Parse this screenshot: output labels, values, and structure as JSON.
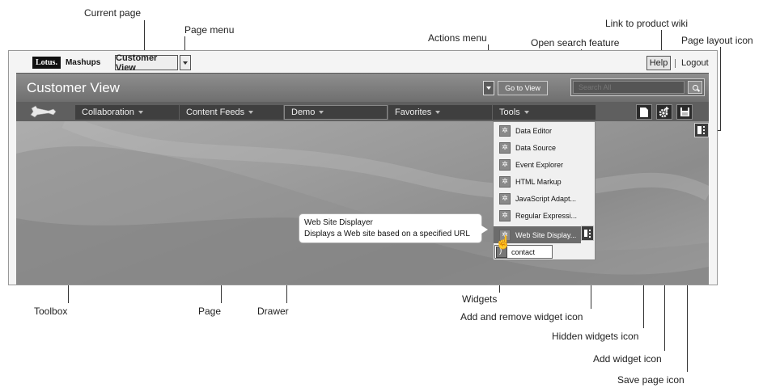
{
  "callouts": {
    "current_page": "Current page",
    "page_menu": "Page menu",
    "actions_menu": "Actions menu",
    "open_search": "Open search feature",
    "product_wiki": "Link to product wiki",
    "page_layout_icon": "Page layout icon",
    "toolbox": "Toolbox",
    "page": "Page",
    "drawer": "Drawer",
    "widgets": "Widgets",
    "add_remove_widget": "Add and remove widget icon",
    "hidden_widgets": "Hidden widgets icon",
    "add_widget": "Add widget icon",
    "save_page": "Save page icon"
  },
  "topbar": {
    "logo_lotus": "Lotus.",
    "logo_mashups": "Mashups",
    "current_page": "Customer View",
    "help": "Help",
    "logout": "Logout"
  },
  "header": {
    "title": "Customer View",
    "goto_label": "Go to View",
    "search_placeholder": "Search All"
  },
  "drawers": [
    {
      "label": "Collaboration"
    },
    {
      "label": "Content Feeds"
    },
    {
      "label": "Demo"
    },
    {
      "label": "Favorites"
    },
    {
      "label": "Tools"
    }
  ],
  "tools_menu": {
    "items": [
      {
        "label": "Data Editor"
      },
      {
        "label": "Data Source"
      },
      {
        "label": "Event Explorer"
      },
      {
        "label": "HTML Markup"
      },
      {
        "label": "JavaScript Adapt..."
      },
      {
        "label": "Regular Expressi..."
      },
      {
        "label": "Web Site Display..."
      }
    ],
    "contact": "contact"
  },
  "tooltip": {
    "title": "Web Site Displayer",
    "description": "Displays a Web site based on a specified URL"
  },
  "icons": {
    "toolbox": "wrench-icon",
    "hidden_widgets": "page-icon",
    "add_widget": "gear-plus-icon",
    "save_page": "floppy-disk-icon",
    "page_layout": "layout-columns-icon"
  }
}
